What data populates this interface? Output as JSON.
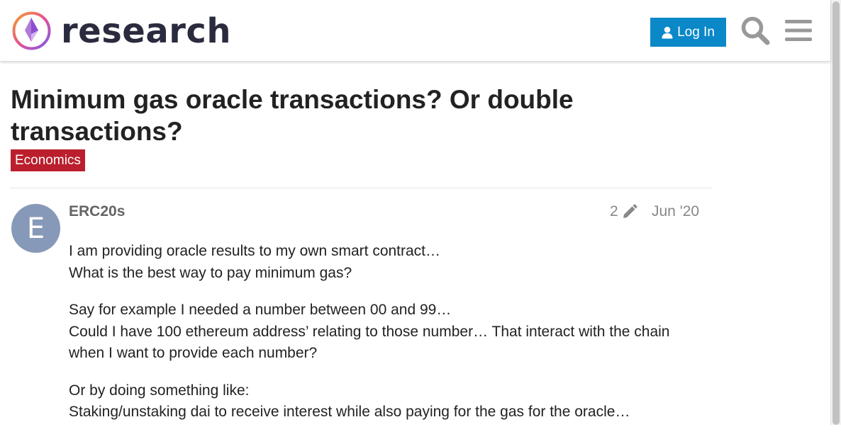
{
  "site": {
    "name": "research"
  },
  "header": {
    "login_label": "Log In"
  },
  "topic": {
    "title": "Minimum gas oracle transactions? Or double transactions?",
    "category": "Economics",
    "category_color": "#bb1e2c"
  },
  "post": {
    "avatar_letter": "E",
    "username": "ERC20s",
    "edit_count": "2",
    "date": "Jun '20",
    "paragraphs": [
      [
        "I am providing oracle results to my own smart contract…",
        "What is the best way to pay minimum gas?"
      ],
      [
        "Say for example I needed a number between 00 and 99…",
        "Could I have 100 ethereum address’ relating to those number… That interact with the chain when I want to provide each number?"
      ],
      [
        "Or by doing something like:",
        "Staking/unstaking dai to receive interest while also paying for the gas for the oracle…"
      ]
    ]
  },
  "colors": {
    "login_button": "#0a88c8",
    "avatar": "#8799b8"
  }
}
